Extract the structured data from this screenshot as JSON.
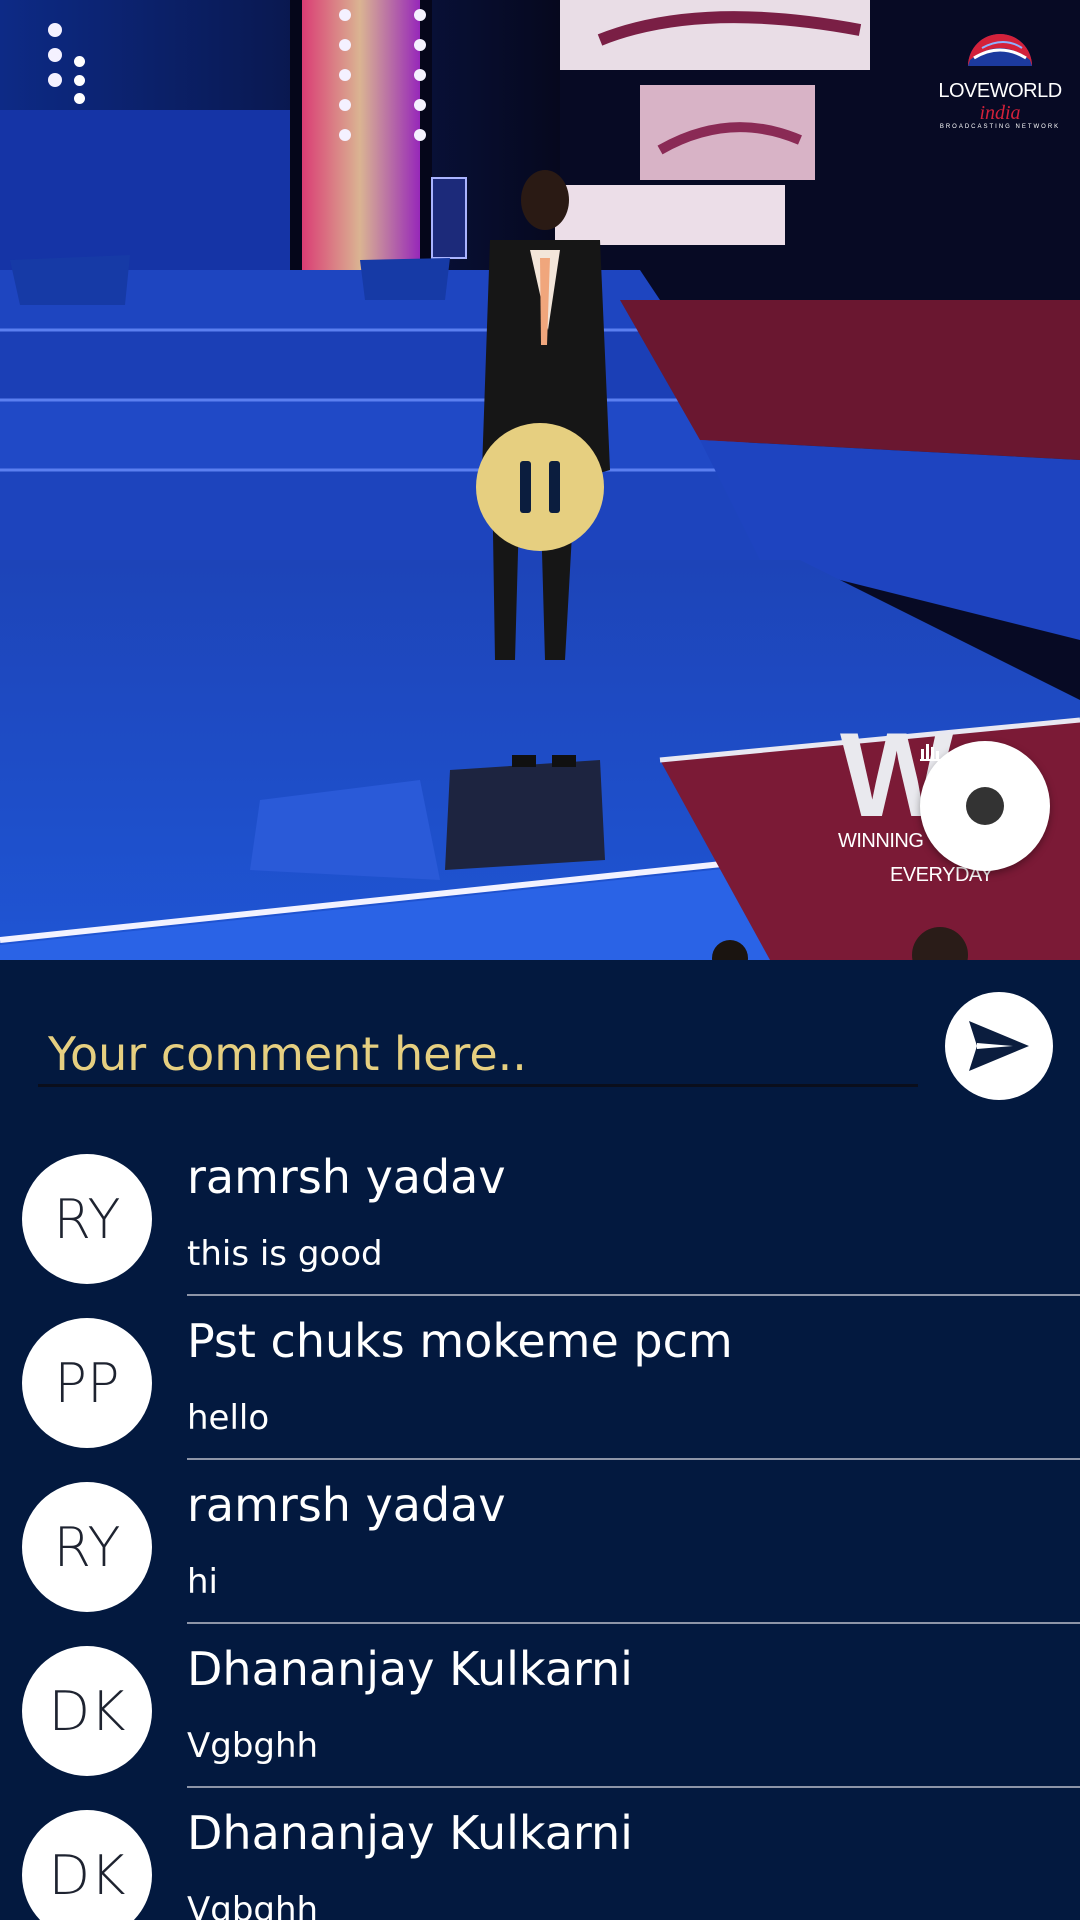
{
  "video": {
    "menu_icon": "vertical-dots-icon",
    "logo": {
      "brand": "LOVEWORLD",
      "sub": "india",
      "tagline": "BROADCASTING NETWORK"
    },
    "pause_icon": "pause-icon",
    "watermark": {
      "letter": "W",
      "line1": "WINNING",
      "line2": "EVERYDAY"
    },
    "fab_icon": "equalizer-icon"
  },
  "comment_box": {
    "placeholder": "Your comment here..",
    "send_icon": "send-icon"
  },
  "comments": [
    {
      "initials": "RY",
      "name": "ramrsh yadav",
      "text": "this is good"
    },
    {
      "initials": "PP",
      "name": "Pst chuks mokeme pcm",
      "text": "hello"
    },
    {
      "initials": "RY",
      "name": "ramrsh yadav",
      "text": "hi"
    },
    {
      "initials": "DK",
      "name": "Dhananjay Kulkarni",
      "text": "Vgbghh"
    },
    {
      "initials": "DK",
      "name": "Dhananjay Kulkarni",
      "text": "Vgbghh"
    }
  ],
  "colors": {
    "background": "#03193f",
    "accent": "#e6cf80",
    "avatar_bg": "#ffffff"
  }
}
